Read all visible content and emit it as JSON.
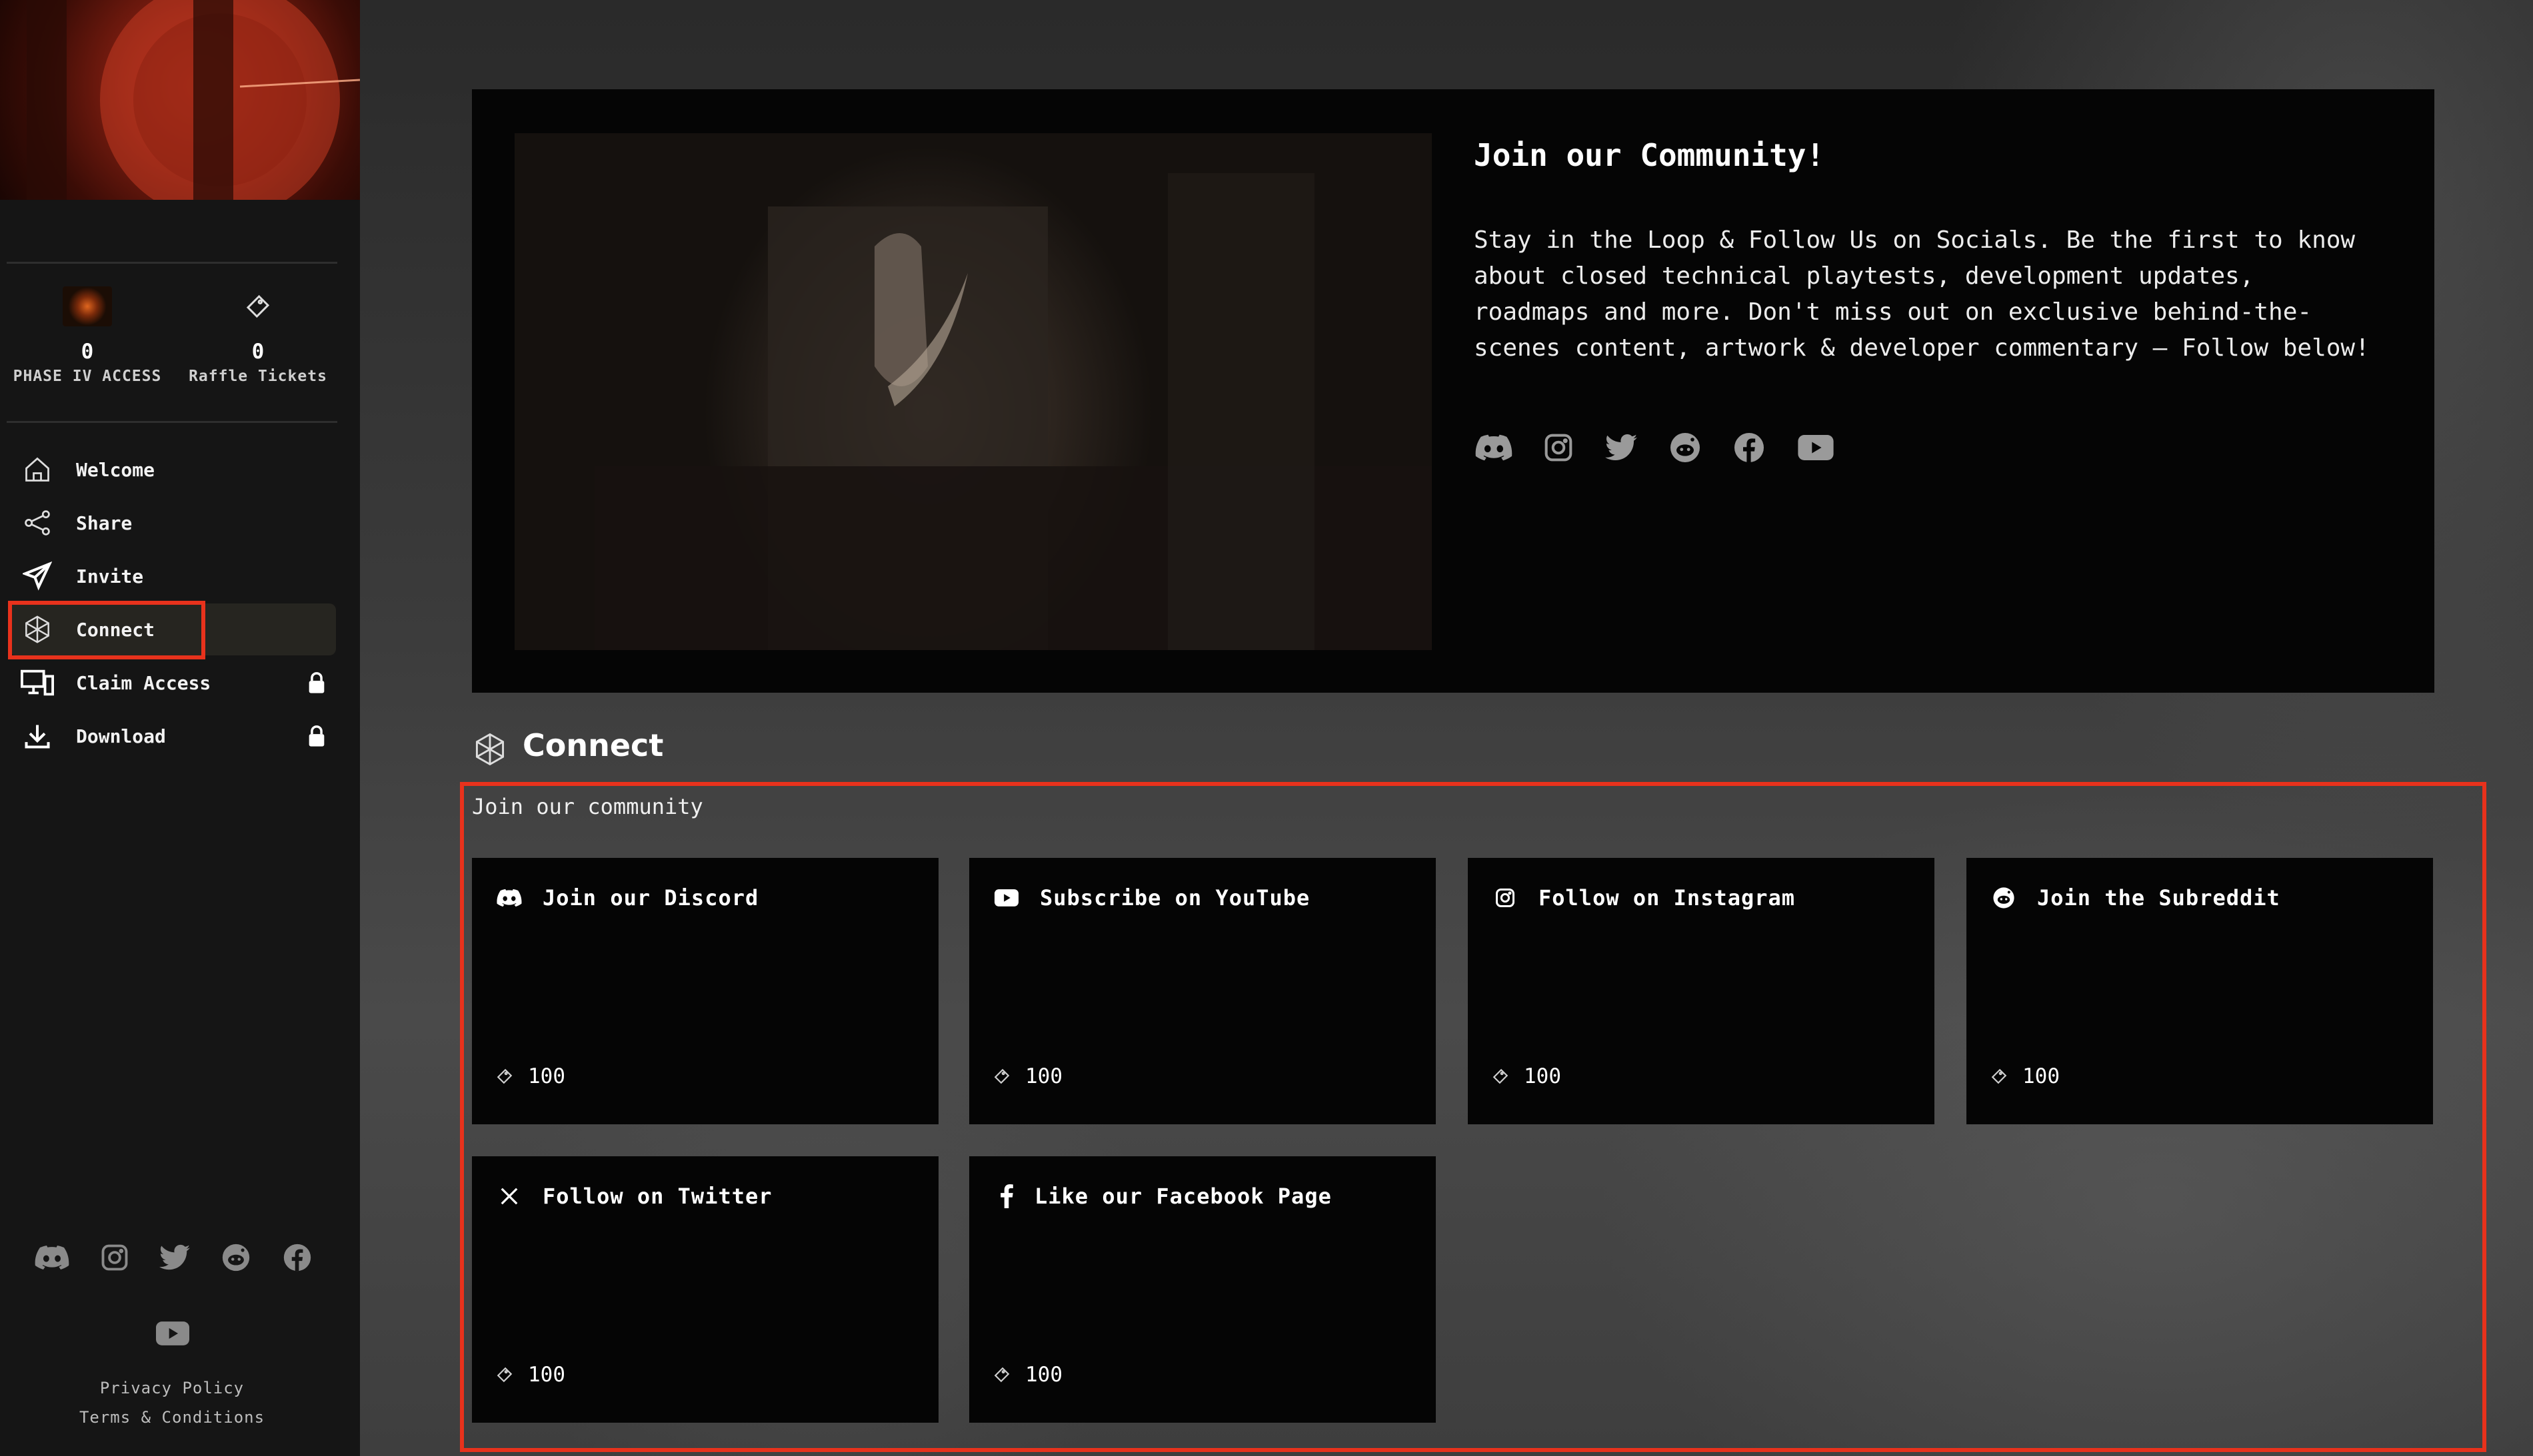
{
  "sidebar": {
    "stats": [
      {
        "value": "0",
        "label": "PHASE IV ACCESS",
        "icon": "phase-badge-icon"
      },
      {
        "value": "0",
        "label": "Raffle Tickets",
        "icon": "ticket-icon"
      }
    ],
    "nav": [
      {
        "label": "Welcome",
        "icon": "home-icon"
      },
      {
        "label": "Share",
        "icon": "share-icon"
      },
      {
        "label": "Invite",
        "icon": "send-icon"
      },
      {
        "label": "Connect",
        "icon": "connect-icon",
        "active": true
      },
      {
        "label": "Claim Access",
        "icon": "devices-icon",
        "locked": true
      },
      {
        "label": "Download",
        "icon": "download-icon",
        "locked": true
      }
    ],
    "socials": [
      "discord-icon",
      "instagram-icon",
      "twitter-icon",
      "reddit-icon",
      "facebook-icon",
      "youtube-icon"
    ],
    "footer": {
      "privacy": "Privacy Policy",
      "terms": "Terms & Conditions"
    }
  },
  "hero": {
    "title": "Join our Community!",
    "text": "Stay in the Loop & Follow Us on Socials. Be the first to know\nabout closed technical playtests, development updates,\nroadmaps and more. Don't miss out on exclusive behind-the-\nscenes content, artwork & developer commentary – Follow below!",
    "socials": [
      "discord-icon",
      "instagram-icon",
      "twitter-icon",
      "reddit-icon",
      "facebook-icon",
      "youtube-icon"
    ]
  },
  "connect": {
    "title": "Connect",
    "subtitle": "Join our community",
    "tasks": [
      {
        "label": "Join our Discord",
        "icon": "discord-icon",
        "points": "100"
      },
      {
        "label": "Subscribe on YouTube",
        "icon": "youtube-icon",
        "points": "100"
      },
      {
        "label": "Follow on Instagram",
        "icon": "instagram-icon",
        "points": "100"
      },
      {
        "label": "Join the Subreddit",
        "icon": "reddit-icon",
        "points": "100"
      },
      {
        "label": "Follow on Twitter",
        "icon": "x-icon",
        "points": "100"
      },
      {
        "label": "Like our Facebook Page",
        "icon": "facebook-icon",
        "points": "100"
      }
    ]
  },
  "colors": {
    "highlight": "#e8321c",
    "panel": "#050505",
    "sidebar": "#151515",
    "active_nav": "#262520"
  }
}
